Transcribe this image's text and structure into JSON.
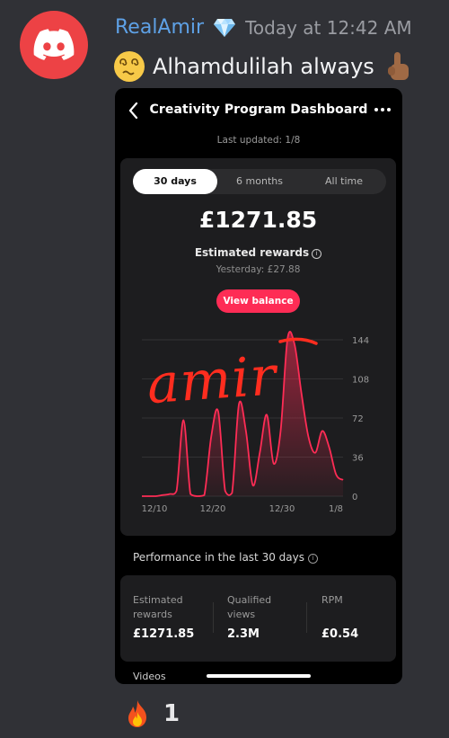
{
  "message": {
    "author": "RealAmir",
    "timestamp": "Today at 12:42 AM",
    "text": "Alhamdulilah always",
    "avatar_icon": "discord-logo-icon",
    "badge_icon": "gem-icon",
    "emoji_start": "dizzy-face-emoji",
    "emoji_end": "pointing-up-hand-emoji",
    "colors": {
      "author": "#5ea1e6",
      "avatar_bg": "#ed4245"
    }
  },
  "phone": {
    "header": {
      "title": "Creativity Program Dashboard",
      "back_icon": "chevron-left-icon",
      "more_icon": "more-horizontal-icon"
    },
    "last_updated": "Last updated: 1/8",
    "tabs": [
      {
        "label": "30 days",
        "active": true
      },
      {
        "label": "6 months",
        "active": false
      },
      {
        "label": "All time",
        "active": false
      }
    ],
    "summary": {
      "amount": "£1271.85",
      "label": "Estimated rewards",
      "yesterday": "Yesterday: £27.88",
      "button": "View balance",
      "accent": "#fe2c55"
    },
    "overlay_text": "amir",
    "performance": {
      "title": "Performance in the last 30 days",
      "stats": [
        {
          "label": "Estimated rewards",
          "value": "£1271.85"
        },
        {
          "label": "Qualified views",
          "value": "2.3M"
        },
        {
          "label": "RPM",
          "value": "£0.54"
        }
      ]
    },
    "videos_label": "Videos"
  },
  "reaction": {
    "emoji": "fire-emoji",
    "count": "1"
  },
  "chart_data": {
    "type": "area",
    "x_tick_labels": [
      "12/10",
      "12/20",
      "12/30",
      "1/8"
    ],
    "y_ticks": [
      0,
      36,
      72,
      108,
      144
    ],
    "ylim": [
      0,
      144
    ],
    "x": [
      0,
      1,
      2,
      3,
      4,
      5,
      6,
      7,
      8,
      9,
      10,
      11,
      12,
      13,
      14,
      15,
      16,
      17,
      18,
      19,
      20,
      21,
      22,
      23,
      24,
      25,
      26,
      27,
      28,
      29
    ],
    "values": [
      0,
      0,
      0,
      1,
      2,
      5,
      70,
      2,
      0,
      1,
      55,
      78,
      5,
      3,
      85,
      60,
      10,
      40,
      75,
      30,
      60,
      145,
      140,
      95,
      55,
      40,
      60,
      45,
      20,
      15
    ],
    "series_color": "#fe2c55",
    "grid": true
  }
}
